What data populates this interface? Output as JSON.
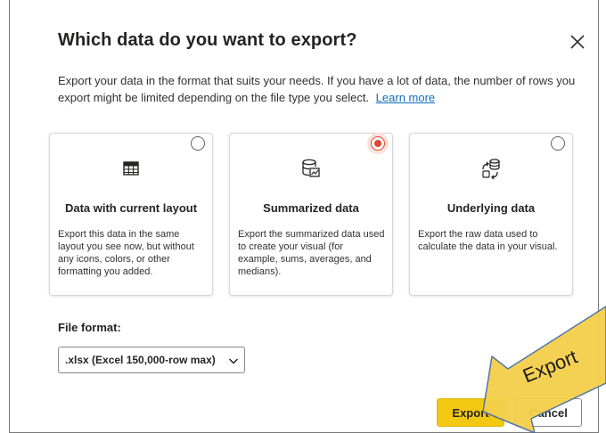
{
  "dialog": {
    "title": "Which data do you want to export?",
    "description": "Export your data in the format that suits your needs. If you have a lot of data, the number of rows you export might be limited depending on the file type you select.",
    "learn_more": "Learn more"
  },
  "options": [
    {
      "icon": "table-grid-icon",
      "title": "Data with current layout",
      "description": "Export this data in the same layout you see now, but without any icons, colors, or other formatting you added.",
      "selected": false
    },
    {
      "icon": "database-chart-icon",
      "title": "Summarized data",
      "description": "Export the summarized data used to create your visual (for example, sums, averages, and medians).",
      "selected": true
    },
    {
      "icon": "data-arrows-icon",
      "title": "Underlying data",
      "description": "Export the raw data used to calculate the data in your visual.",
      "selected": false
    }
  ],
  "file_format": {
    "label": "File format:",
    "value": ".xlsx (Excel 150,000-row max)"
  },
  "buttons": {
    "export": "Export",
    "cancel": "Cancel"
  },
  "annotation": {
    "text": "Export"
  },
  "colors": {
    "accent": "#e2442f",
    "primary_button": "#f2c811",
    "callout_arrow": "#f5cf4a",
    "link": "#0f6cbd"
  }
}
